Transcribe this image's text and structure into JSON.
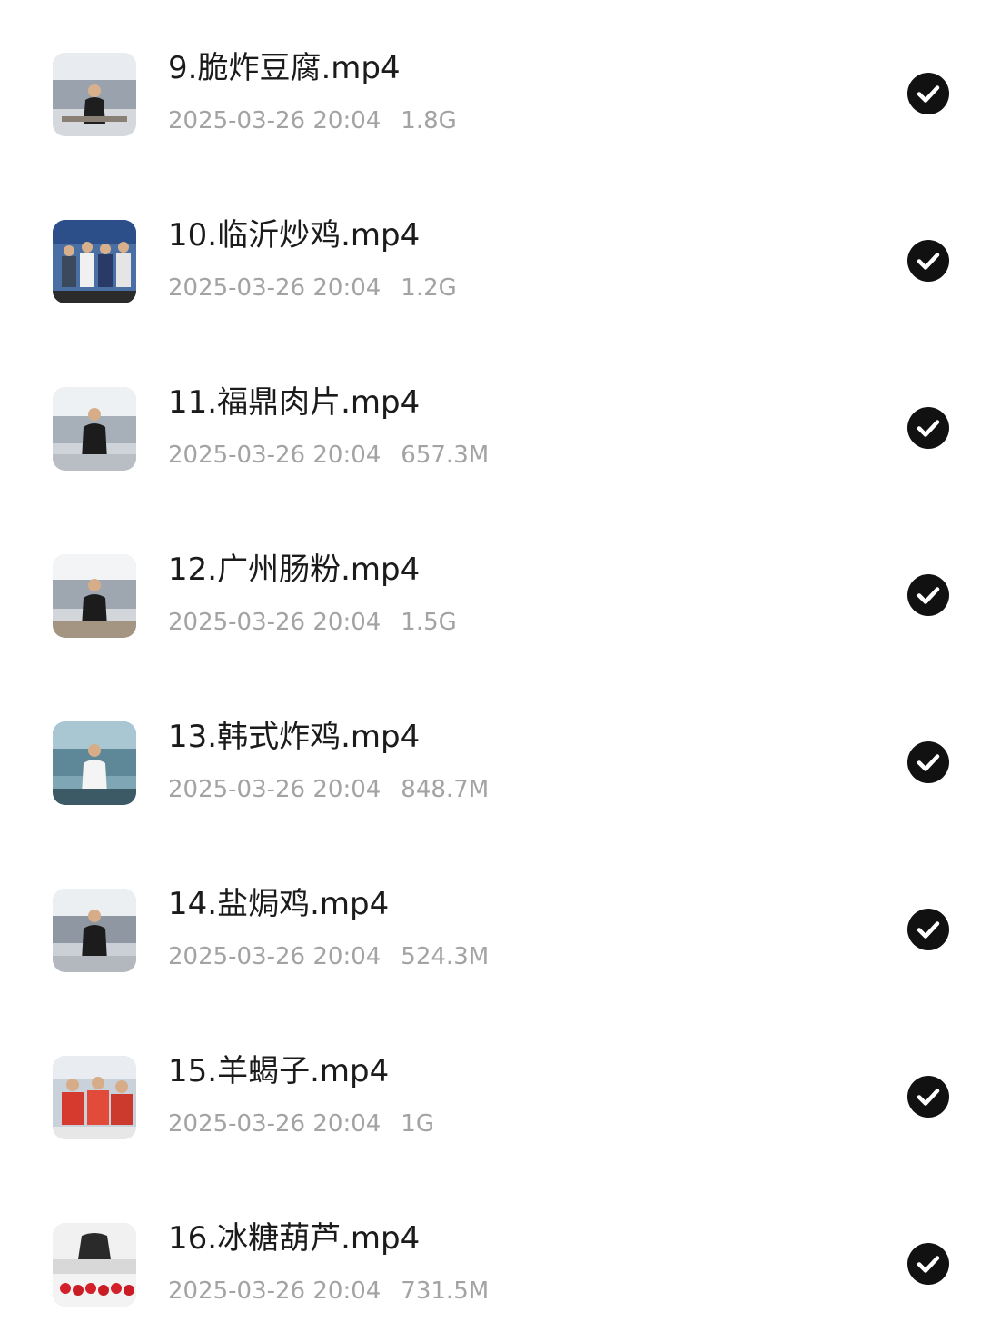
{
  "files": [
    {
      "name": "9.脆炸豆腐.mp4",
      "date": "2025-03-26 20:04",
      "size": "1.8G",
      "thumb": "chef-kitchen-icon",
      "checked": true
    },
    {
      "name": "10.临沂炒鸡.mp4",
      "date": "2025-03-26 20:04",
      "size": "1.2G",
      "thumb": "group-photo-icon",
      "checked": true
    },
    {
      "name": "11.福鼎肉片.mp4",
      "date": "2025-03-26 20:04",
      "size": "657.3M",
      "thumb": "chef-kitchen-icon",
      "checked": true
    },
    {
      "name": "12.广州肠粉.mp4",
      "date": "2025-03-26 20:04",
      "size": "1.5G",
      "thumb": "chef-kitchen-icon",
      "checked": true
    },
    {
      "name": "13.韩式炸鸡.mp4",
      "date": "2025-03-26 20:04",
      "size": "848.7M",
      "thumb": "chef-white-icon",
      "checked": true
    },
    {
      "name": "14.盐焗鸡.mp4",
      "date": "2025-03-26 20:04",
      "size": "524.3M",
      "thumb": "chef-kitchen-icon",
      "checked": true
    },
    {
      "name": "15.羊蝎子.mp4",
      "date": "2025-03-26 20:04",
      "size": "1G",
      "thumb": "group-red-icon",
      "checked": true
    },
    {
      "name": "16.冰糖葫芦.mp4",
      "date": "2025-03-26 20:04",
      "size": "731.5M",
      "thumb": "candied-fruit-icon",
      "checked": true
    }
  ],
  "colors": {
    "title": "#1b1b1b",
    "meta": "#a3a3a3",
    "check_bg": "#111111",
    "check_mark": "#ffffff"
  }
}
